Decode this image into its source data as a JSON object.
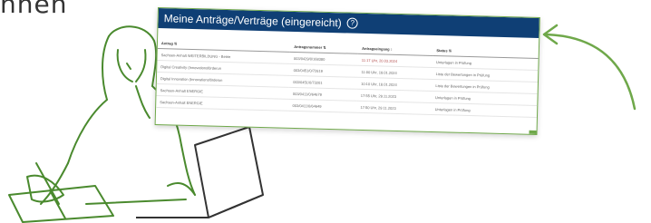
{
  "heading_partial": "hnen",
  "card": {
    "title": "Meine Anträge/Verträge (eingereicht)",
    "help_icon": "?",
    "table": {
      "headers": [
        "Antrag ⇅",
        "Antragsnummer ⇅",
        "Antragseingang ↕",
        "Status ⇅"
      ],
      "rows": [
        [
          "Sachsen-Anhalt WEITERBILDUNG - Betrie",
          "003/0429/0/168380",
          "11:17 Uhr, 20.03.2024",
          "Unterlagen in Prüfung"
        ],
        [
          "Digital Creativity (Innovationsförderun",
          "003/0451/0/72619",
          "11:00 Uhr, 19.01.2024",
          "Liste der Bewertungen in Prüfung"
        ],
        [
          "Digital Innovation (Innovationsförderun",
          "003/0451/0/73201",
          "10:10 Uhr, 18.01.2024",
          "Liste der Bewertungen in Prüfung"
        ],
        [
          "Sachsen-Anhalt ENERGIE",
          "003/0411/0/64679",
          "17:55 Uhr, 29.11.2023",
          "Unterlagen in Prüfung"
        ],
        [
          "Sachsen-Anhalt ENERGIE",
          "003/0411/0/64649",
          "17:50 Uhr, 29.11.2023",
          "Unterlagen in Prüfung"
        ]
      ]
    }
  },
  "colors": {
    "header_bg": "#0f3f75",
    "accent_green": "#6fa84a",
    "line_drawing": "#4a8a2e"
  }
}
